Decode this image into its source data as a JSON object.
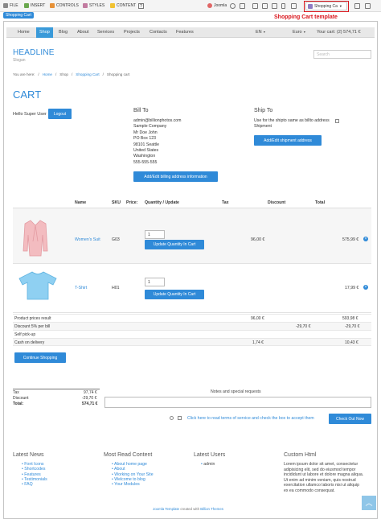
{
  "toolbar": {
    "file": "FILE",
    "insert": "INSERT",
    "controls": "CONTROLS",
    "styles": "STYLES",
    "content": "CONTENT",
    "joomla": "Joomla",
    "template_select": "Shopping Ca",
    "annotation": "Shopping Cart template",
    "badge": "Shopping Cart"
  },
  "nav": {
    "items": [
      "Home",
      "Shop",
      "Blog",
      "About",
      "Services",
      "Projects",
      "Contacts",
      "Features"
    ],
    "active": "Shop",
    "language": "EN",
    "currency": "Euro",
    "cart": "Your cart: (2) 574,71 €"
  },
  "header": {
    "headline": "HEADLINE",
    "slogan": "Slogan",
    "search_placeholder": "Search"
  },
  "breadcrumb": [
    "You are here:",
    "Home",
    "Shop",
    "Shopping Cart",
    "Shopping cart"
  ],
  "cart": {
    "title": "CART",
    "hello": "Hello Super User",
    "logout": "Logout",
    "bill_to": {
      "heading": "Bill To",
      "lines": [
        "admin@billionphotos.com",
        "Sample Company",
        "Mr Doe John",
        "PO Box 123",
        "98101 Seattle",
        "United States",
        "Washington",
        "555-555-555"
      ],
      "button": "Add/Edit billing address information"
    },
    "ship_to": {
      "heading": "Ship To",
      "text": "Use for the shipto same as billto address",
      "text2": "Shipment",
      "button": "Add/Edit shipment address"
    },
    "columns": [
      "Name",
      "SKU",
      "Price:",
      "Quantity / Update",
      "Tax",
      "Discount",
      "Total"
    ],
    "items": [
      {
        "name": "Women's Suit",
        "sku": "G03",
        "qty": "1",
        "update": "Update Quantity In Cart",
        "tax": "96,00 €",
        "total": "575,99 €"
      },
      {
        "name": "T-Shirt",
        "sku": "H01",
        "qty": "1",
        "update": "Update Quantity In Cart",
        "tax": "",
        "total": "17,99 €"
      }
    ],
    "summary": [
      {
        "label": "Product prices result",
        "tax": "96,00 €",
        "discount": "",
        "total": "593,98 €"
      },
      {
        "label": "Discount 5% per bill",
        "tax": "",
        "discount": "-29,70 €",
        "total": "-29,70 €"
      },
      {
        "label": "Self pick-up",
        "tax": "",
        "discount": "",
        "total": ""
      },
      {
        "label": "Cash on delivery",
        "tax": "1,74 €",
        "discount": "",
        "total": "10,43 €"
      }
    ],
    "continue": "Continue Shopping",
    "totals": [
      {
        "label": "Tax",
        "value": "97,74 €"
      },
      {
        "label": "Discount",
        "value": "-29,70 €"
      },
      {
        "label": "Total:",
        "value": "574,71 €"
      }
    ],
    "notes_label": "Notes and special requests",
    "terms": "Click here to read terms of service and check the box to accept them",
    "checkout": "Check Out Now"
  },
  "footer": {
    "news": {
      "heading": "Latest News",
      "items": [
        "Font Icons",
        "Shortcodes",
        "Features",
        "Testimonials",
        "FAQ"
      ]
    },
    "most_read": {
      "heading": "Most Read Content",
      "items": [
        "About home page",
        "About",
        "Working on Your Site",
        "Welcome to blog",
        "Your Modules"
      ]
    },
    "users": {
      "heading": "Latest Users",
      "items": [
        "admin"
      ]
    },
    "custom": {
      "heading": "Custom Html",
      "text": "Lorem ipsum dolor sit amet, consectetur adipisicing elit, sed do eiusmod tempor incididunt ut labore et dolore magna aliqua. Ut enim ad minim veniam, quis nostrud exercitation ullamco laboris nisi ut aliquip ex ea commodo consequat."
    },
    "credit_a": "Joomla Template",
    "credit_b": "created with",
    "credit_c": "Billion Themes"
  },
  "colors": {
    "accent": "#2f8ad8",
    "annotation": "#d9161d"
  }
}
